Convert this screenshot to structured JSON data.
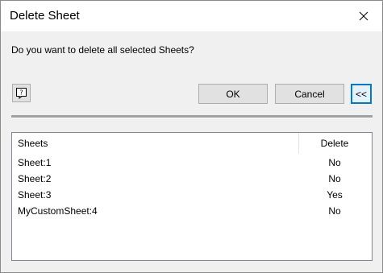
{
  "window": {
    "title": "Delete Sheet",
    "close_icon": "close-icon"
  },
  "prompt": "Do you want to delete all selected Sheets?",
  "toolbar": {
    "help_icon": "help-icon",
    "ok_label": "OK",
    "cancel_label": "Cancel",
    "collapse_label": "<<"
  },
  "table": {
    "columns": [
      "Sheets",
      "Delete"
    ],
    "rows": [
      {
        "sheet": "Sheet:1",
        "delete": "No"
      },
      {
        "sheet": "Sheet:2",
        "delete": "No"
      },
      {
        "sheet": "Sheet:3",
        "delete": "Yes"
      },
      {
        "sheet": "MyCustomSheet:4",
        "delete": "No"
      }
    ]
  },
  "colors": {
    "accent": "#0078d7",
    "dialog_bg": "#f0f0f0",
    "button_bg": "#e1e1e1"
  }
}
